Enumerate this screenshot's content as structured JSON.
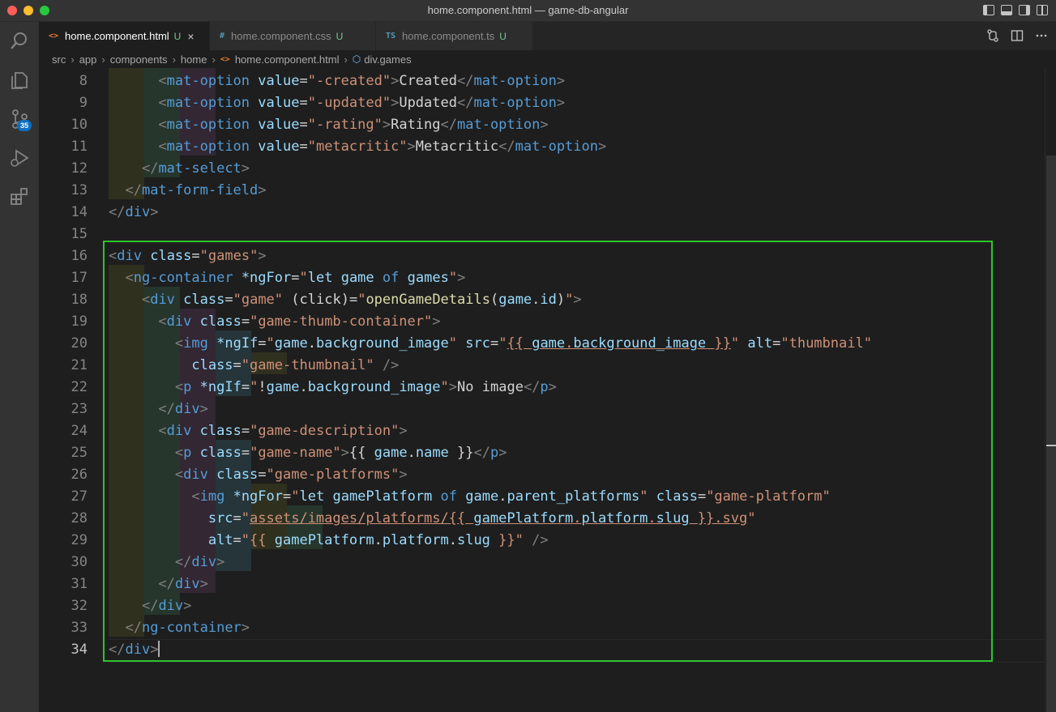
{
  "window": {
    "title": "home.component.html — game-db-angular",
    "traffic_lights": [
      "#ff5f57",
      "#febc2e",
      "#28c840"
    ]
  },
  "activity_bar": {
    "items": [
      {
        "name": "explorer-search-icon"
      },
      {
        "name": "explorer-files-icon"
      },
      {
        "name": "source-control-icon",
        "badge": "35"
      },
      {
        "name": "run-debug-icon"
      },
      {
        "name": "extensions-icon"
      }
    ]
  },
  "tabs": [
    {
      "icon": "<>",
      "label": "home.component.html",
      "status": "U",
      "close": "×",
      "active": true,
      "icon_color": "#e37933"
    },
    {
      "icon": "#",
      "label": "home.component.css",
      "status": "U",
      "active": false,
      "icon_color": "#519aba"
    },
    {
      "icon": "TS",
      "label": "home.component.ts",
      "status": "U",
      "active": false,
      "icon_color": "#519aba"
    }
  ],
  "breadcrumb": [
    "src",
    "app",
    "components",
    "home",
    "home.component.html",
    "div.games"
  ],
  "editor": {
    "current_line": 34,
    "lines": [
      {
        "num": "8"
      },
      {
        "num": "9"
      },
      {
        "num": "10"
      },
      {
        "num": "11"
      },
      {
        "num": "12"
      },
      {
        "num": "13"
      },
      {
        "num": "14"
      },
      {
        "num": "15"
      },
      {
        "num": "16"
      },
      {
        "num": "17"
      },
      {
        "num": "18"
      },
      {
        "num": "19"
      },
      {
        "num": "20"
      },
      {
        "num": "21"
      },
      {
        "num": "22"
      },
      {
        "num": "23"
      },
      {
        "num": "24"
      },
      {
        "num": "25"
      },
      {
        "num": "26"
      },
      {
        "num": "27"
      },
      {
        "num": "28"
      },
      {
        "num": "29"
      },
      {
        "num": "30"
      },
      {
        "num": "31"
      },
      {
        "num": "32"
      },
      {
        "num": "33"
      },
      {
        "num": "34"
      }
    ]
  },
  "colors": {
    "highlight_box": "#2ec42e",
    "indent_1": "#30301f",
    "indent_2": "#26362c",
    "indent_3": "#322733",
    "indent_4": "#26353a"
  }
}
